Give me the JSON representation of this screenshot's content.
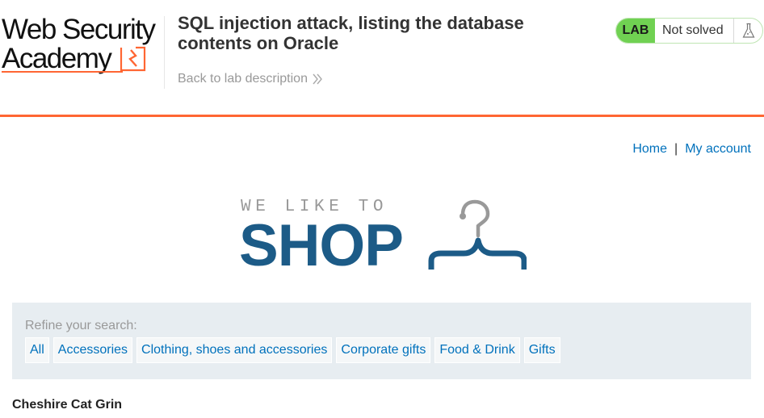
{
  "header": {
    "logo_line1": "Web Security",
    "logo_line2": "Academy",
    "lab_title": "SQL injection attack, listing the database contents on Oracle",
    "back_link": "Back to lab description",
    "status": {
      "tag": "LAB",
      "state": "Not solved"
    }
  },
  "nav": {
    "home": "Home",
    "separator": "|",
    "account": "My account"
  },
  "shop_logo": {
    "tagline": "WE LIKE TO",
    "word": "SHOP"
  },
  "filters": {
    "label": "Refine your search:",
    "categories": [
      "All",
      "Accessories",
      "Clothing, shoes and accessories",
      "Corporate gifts",
      "Food & Drink",
      "Gifts"
    ]
  },
  "products": [
    {
      "name": "Cheshire Cat Grin"
    }
  ],
  "colors": {
    "accent": "#ff6633",
    "link": "#0071bc",
    "lab_tag": "#70d152",
    "shop_blue": "#1c5b87",
    "panel": "#e7edf1"
  },
  "icons": [
    "academy-mark-icon",
    "chevron-right-double-icon",
    "flask-icon",
    "hanger-icon"
  ]
}
